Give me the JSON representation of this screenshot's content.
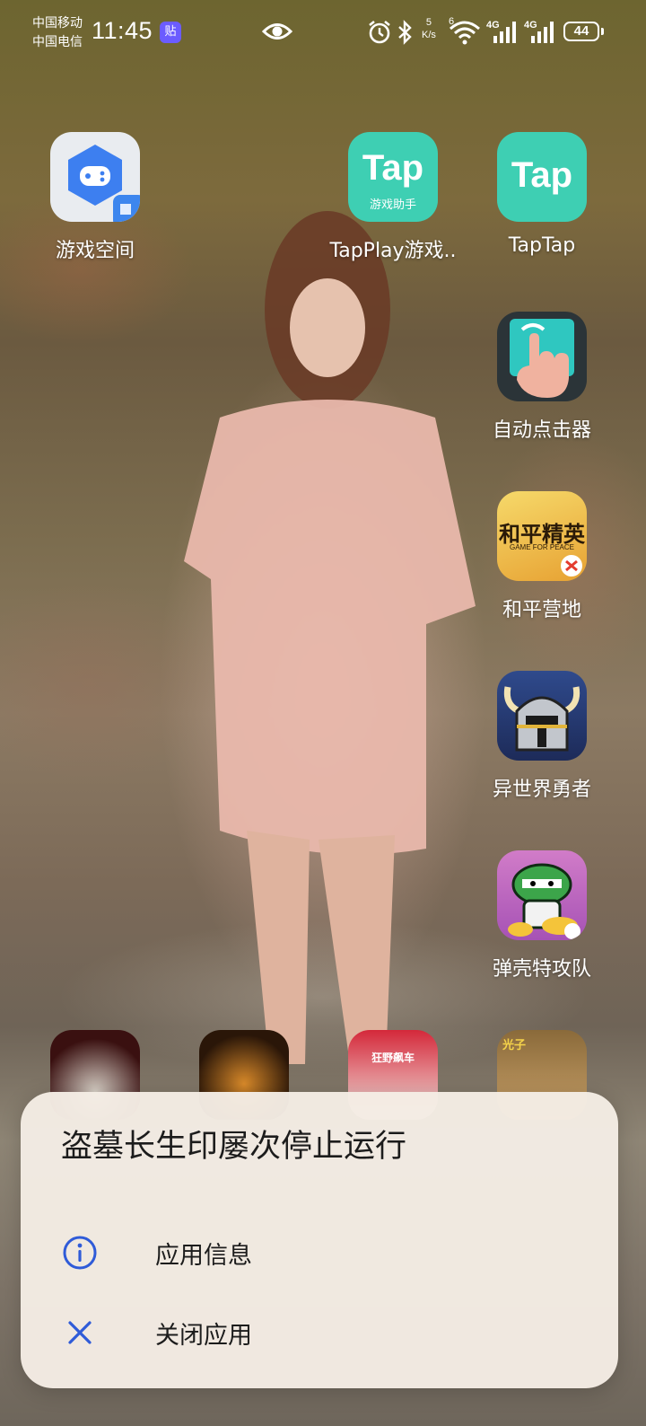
{
  "status_bar": {
    "carrier_1": "中国移动",
    "carrier_2": "中国电信",
    "time": "11:45",
    "notif_badge": "贴",
    "speed_value": "5",
    "speed_unit": "K/s",
    "wifi_tag": "6",
    "sim1_type": "4G",
    "sim2_type": "4G",
    "battery": "44"
  },
  "apps": [
    {
      "label": "游戏空间",
      "icon": "game-space-icon"
    },
    {
      "label": "TapPlay游戏..",
      "icon": "tapplay-icon",
      "icon_text": "Tap",
      "icon_subtext": "游戏助手"
    },
    {
      "label": "TapTap",
      "icon": "taptap-icon",
      "icon_text": "Tap"
    },
    {
      "label": "自动点击器",
      "icon": "auto-clicker-icon"
    },
    {
      "label": "和平营地",
      "icon": "peace-camp-icon",
      "icon_text": "和平精英",
      "icon_subtext": "GAME FOR PEACE"
    },
    {
      "label": "异世界勇者",
      "icon": "otherworld-hero-icon"
    },
    {
      "label": "弹壳特攻队",
      "icon": "survivor-io-icon"
    }
  ],
  "dock_row_partial": [
    {
      "icon": "app-icon-1"
    },
    {
      "icon": "app-icon-2"
    },
    {
      "icon": "app-icon-3",
      "icon_text": "狂野飙车"
    },
    {
      "icon": "app-icon-4",
      "icon_text": "光子"
    }
  ],
  "dialog": {
    "title": "盗墓长生印屡次停止运行",
    "items": [
      {
        "label": "应用信息",
        "icon": "info-icon"
      },
      {
        "label": "关闭应用",
        "icon": "close-icon"
      }
    ]
  },
  "colors": {
    "dialog_bg": "#f4ece4",
    "accent_icon": "#2f5bd8",
    "tap_green": "#3ecfb3"
  }
}
